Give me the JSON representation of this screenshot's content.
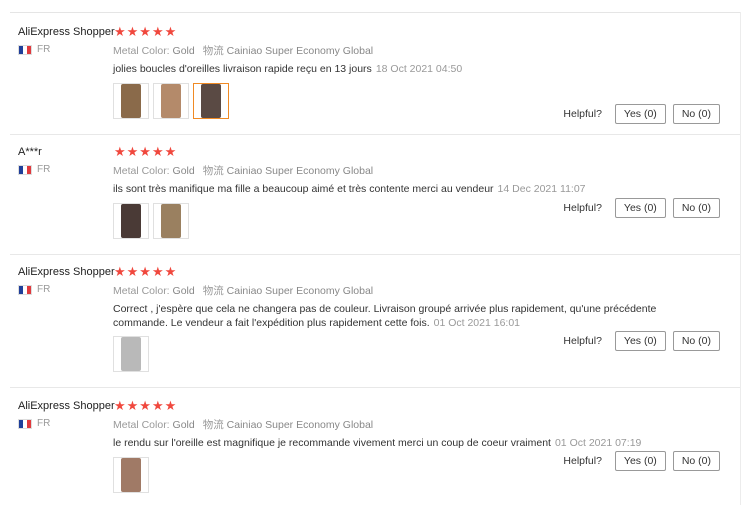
{
  "helpful_label": "Helpful?",
  "star_color": "#f0483e",
  "selected_thumb_color": "#f08a24",
  "attr_labels": {
    "metal": "Metal Color:",
    "shipping": "物流"
  },
  "reviews": [
    {
      "user": "AliExpress Shopper",
      "country": "FR",
      "stars": "★★★★★",
      "metal": "Gold",
      "shipping": "Cainiao Super Economy Global",
      "text": "jolies boucles d'oreilles livraison rapide reçu en 13 jours",
      "date": "18 Oct 2021 04:50",
      "yes": "Yes (0)",
      "no": "No (0)",
      "thumbs": [
        {
          "name": "review-photo",
          "color": "#8a6a4a",
          "selected": false
        },
        {
          "name": "review-photo",
          "color": "#b48a6a",
          "selected": false
        },
        {
          "name": "review-photo",
          "color": "#5a4a44",
          "selected": true
        }
      ]
    },
    {
      "user": "A***r",
      "country": "FR",
      "stars": "★★★★★",
      "metal": "Gold",
      "shipping": "Cainiao Super Economy Global",
      "text": "ils sont très manifique ma fille a beaucoup aimé et très contente merci au vendeur",
      "date": "14 Dec 2021 11:07",
      "yes": "Yes (0)",
      "no": "No (0)",
      "thumbs": [
        {
          "name": "review-photo",
          "color": "#4a3a36",
          "selected": false
        },
        {
          "name": "review-photo",
          "color": "#9a8060",
          "selected": false
        }
      ]
    },
    {
      "user": "AliExpress Shopper",
      "country": "FR",
      "stars": "★★★★★",
      "metal": "Gold",
      "shipping": "Cainiao Super Economy Global",
      "text": "Correct , j'espère que cela ne changera pas de couleur. Livraison groupé arrivée plus rapidement, qu'une précédente commande. Le vendeur a fait l'expédition plus rapidement cette fois.",
      "date": "01 Oct 2021 16:01",
      "yes": "Yes (0)",
      "no": "No (0)",
      "thumbs": [
        {
          "name": "review-photo",
          "color": "#b9b9b9",
          "selected": false
        }
      ]
    },
    {
      "user": "AliExpress Shopper",
      "country": "FR",
      "stars": "★★★★★",
      "metal": "Gold",
      "shipping": "Cainiao Super Economy Global",
      "text": "le rendu sur l'oreille est magnifique je recommande vivement merci un coup de coeur vraiment",
      "date": "01 Oct 2021 07:19",
      "yes": "Yes (0)",
      "no": "No (0)",
      "thumbs": [
        {
          "name": "review-photo",
          "color": "#a07a66",
          "selected": false
        }
      ]
    }
  ]
}
